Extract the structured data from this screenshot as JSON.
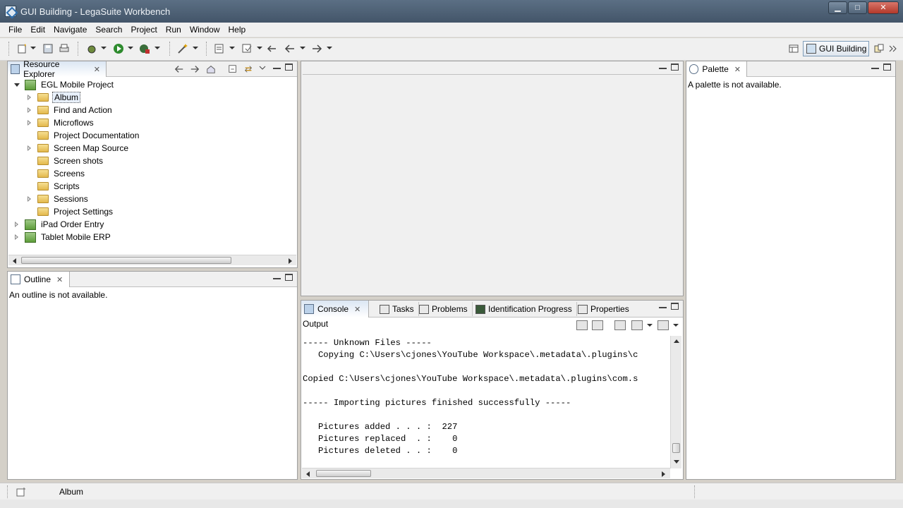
{
  "window": {
    "title": "GUI Building - LegaSuite Workbench",
    "min_label": "▁",
    "max_label": "□",
    "close_label": "✕"
  },
  "menu": [
    "File",
    "Edit",
    "Navigate",
    "Search",
    "Project",
    "Run",
    "Window",
    "Help"
  ],
  "toolbar": {
    "perspective_label": "GUI Building"
  },
  "resource_explorer": {
    "tab_label": "Resource Explorer",
    "tree": [
      {
        "label": "EGL Mobile Project",
        "level": 0,
        "state": "expanded",
        "icon": "project-icon"
      },
      {
        "label": "Album",
        "level": 1,
        "state": "collapsed",
        "icon": "folder-icon",
        "selected": true
      },
      {
        "label": "Find and Action",
        "level": 1,
        "state": "collapsed",
        "icon": "folder-icon"
      },
      {
        "label": "Microflows",
        "level": 1,
        "state": "collapsed",
        "icon": "folder-icon"
      },
      {
        "label": "Project Documentation",
        "level": 1,
        "state": "none",
        "icon": "folder-icon"
      },
      {
        "label": "Screen Map Source",
        "level": 1,
        "state": "collapsed",
        "icon": "folder-icon"
      },
      {
        "label": "Screen shots",
        "level": 1,
        "state": "none",
        "icon": "folder-icon"
      },
      {
        "label": "Screens",
        "level": 1,
        "state": "none",
        "icon": "folder-icon"
      },
      {
        "label": "Scripts",
        "level": 1,
        "state": "none",
        "icon": "folder-icon"
      },
      {
        "label": "Sessions",
        "level": 1,
        "state": "collapsed",
        "icon": "folder-icon"
      },
      {
        "label": "Project Settings",
        "level": 1,
        "state": "none",
        "icon": "folder-icon"
      },
      {
        "label": "iPad Order Entry",
        "level": 0,
        "state": "collapsed",
        "icon": "project-icon"
      },
      {
        "label": "Tablet Mobile ERP",
        "level": 0,
        "state": "collapsed",
        "icon": "project-icon"
      }
    ]
  },
  "outline": {
    "tab_label": "Outline",
    "message": "An outline is not available."
  },
  "palette": {
    "tab_label": "Palette",
    "message": "A palette is not available."
  },
  "console": {
    "tabs": [
      {
        "label": "Console",
        "active": true
      },
      {
        "label": "Tasks"
      },
      {
        "label": "Problems"
      },
      {
        "label": "Identification Progress"
      },
      {
        "label": "Properties"
      }
    ],
    "output_label": "Output",
    "lines": [
      "----- Unknown Files -----",
      "   Copying C:\\Users\\cjones\\YouTube Workspace\\.metadata\\.plugins\\c",
      "",
      "Copied C:\\Users\\cjones\\YouTube Workspace\\.metadata\\.plugins\\com.s",
      "",
      "----- Importing pictures finished successfully -----",
      "",
      "   Pictures added . . . :  227",
      "   Pictures replaced  . :    0",
      "   Pictures deleted . . :    0"
    ]
  },
  "statusbar": {
    "selection": "Album"
  }
}
